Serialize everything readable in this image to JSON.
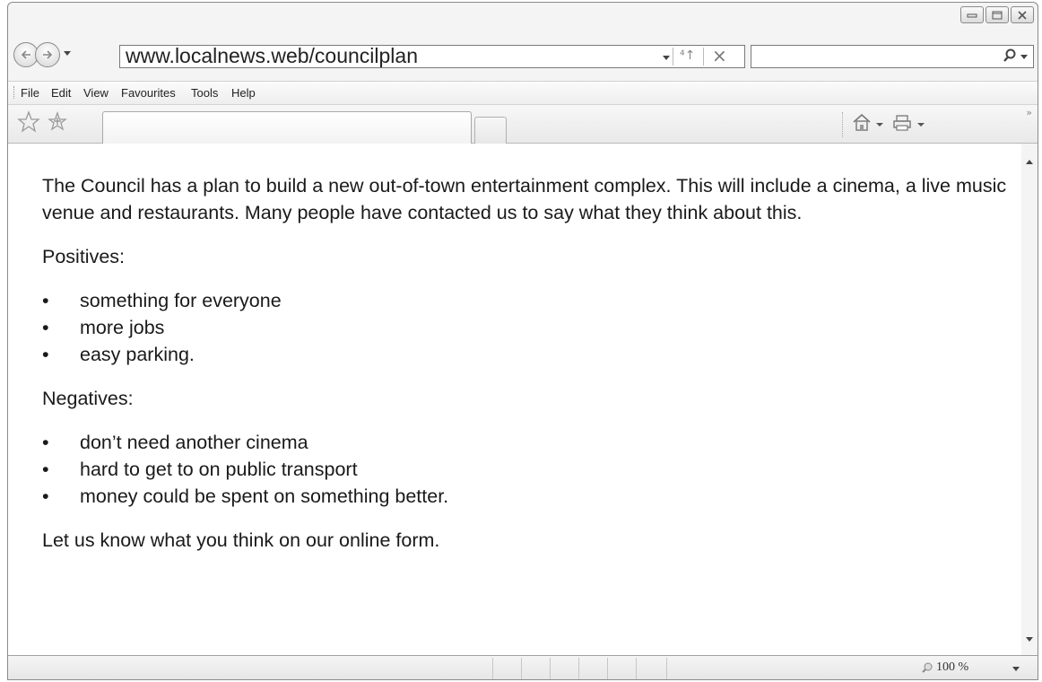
{
  "browser": {
    "address": "www.localnews.web/councilplan",
    "search": {
      "value": "",
      "placeholder": ""
    },
    "menu": [
      "File",
      "Edit",
      "View",
      "Favourites",
      "Tools",
      "Help"
    ],
    "zoom": "100 %"
  },
  "page": {
    "intro": "The Council has a plan to build a new out-of-town entertainment complex. This will include a cinema, a live music venue and restaurants. Many people have contacted us to say what they think about this.",
    "positives_heading": "Positives:",
    "positives": [
      "something for everyone",
      "more jobs",
      "easy parking."
    ],
    "negatives_heading": "Negatives:",
    "negatives": [
      "don’t need another cinema",
      "hard to get to on public transport",
      "money could be spent on something better."
    ],
    "closing": "Let us know what you think on our online form.",
    "bullet": "•"
  },
  "colors": {
    "chrome": "#f4f4f4",
    "border": "#8a8a8a",
    "text": "#1a1a1a"
  }
}
